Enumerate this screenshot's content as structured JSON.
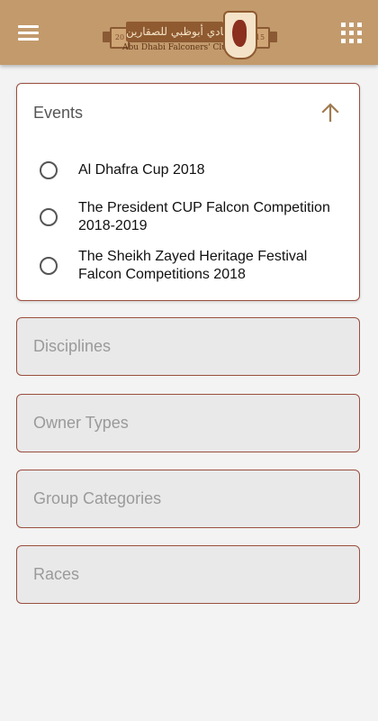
{
  "header": {
    "menu_icon": "hamburger-menu-icon",
    "apps_icon": "grid-apps-icon",
    "logo": {
      "arabic_text": "نادي أبوظبي للصقارين",
      "english_text": "Abu Dhabi Falconers' Club",
      "year_left": "20",
      "year_right": "15",
      "emblem_icon": "falcon-shield-icon"
    }
  },
  "filters": {
    "events": {
      "label": "Events",
      "expanded": true,
      "toggle_icon": "arrow-up-icon",
      "options": [
        {
          "label": "Al Dhafra Cup 2018",
          "selected": false
        },
        {
          "label": "The President CUP Falcon Competition 2018-2019",
          "selected": false
        },
        {
          "label": "The Sheikh Zayed Heritage Festival Falcon Competitions 2018",
          "selected": false
        }
      ]
    },
    "disciplines": {
      "label": "Disciplines"
    },
    "owner_types": {
      "label": "Owner Types"
    },
    "group_categories": {
      "label": "Group Categories"
    },
    "races": {
      "label": "Races"
    }
  },
  "colors": {
    "header_bg": "#c29a6c",
    "card_border": "#9a4f3e",
    "accent_arrow": "#a07a4f",
    "disabled_card_bg": "#e9e9e9",
    "page_bg": "#f3f3f3"
  }
}
